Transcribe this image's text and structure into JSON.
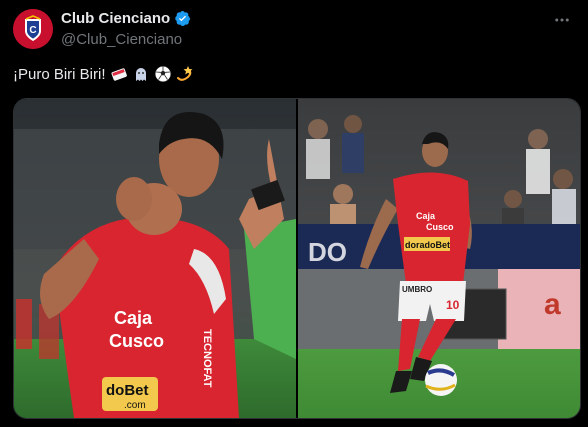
{
  "post": {
    "author": {
      "display_name": "Club Cienciano",
      "handle": "@Club_Cienciano",
      "avatar_icon": "cienciano-crest-icon",
      "verified_icon": "verified-badge-icon"
    },
    "text": "¡Puro Biri Biri!",
    "emojis": [
      "card-icon",
      "ghost-icon",
      "soccer-ball-icon",
      "dizzy-icon"
    ],
    "more_icon": "more-options-icon",
    "media": [
      {
        "name": "celebration-photo",
        "jersey_sponsor_top": "Caja",
        "jersey_sponsor_mid": "Cusco",
        "jersey_sponsor_bottom": "doBet",
        "jersey_sponsor_bottom2": ".com",
        "sleeve_text": "TECNOFAT"
      },
      {
        "name": "match-photo",
        "jersey_sponsor_top": "Caja",
        "jersey_sponsor_mid": "Cusco",
        "jersey_sponsor_bottom": "doradoBet",
        "jersey_number": "10",
        "shorts_text": "UMBRO",
        "board_text": "a"
      }
    ]
  },
  "colors": {
    "background": "#000000",
    "text": "#e7e9ea",
    "muted": "#71767b",
    "verified": "#1d9bf0",
    "club_red": "#d9252f"
  }
}
